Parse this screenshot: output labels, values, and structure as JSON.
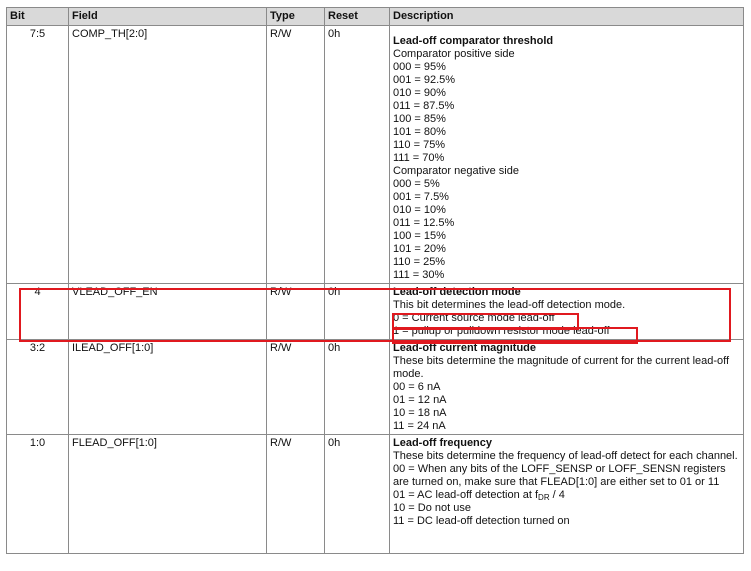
{
  "table": {
    "headers": {
      "bit": "Bit",
      "field": "Field",
      "type": "Type",
      "reset": "Reset",
      "description": "Description"
    },
    "rows": [
      {
        "bit": "7:5",
        "field": "COMP_TH[2:0]",
        "type": "R/W",
        "reset": "0h",
        "title": "Lead-off comparator threshold",
        "lines": [
          "Comparator positive side",
          "000 = 95%",
          "001 = 92.5%",
          "010 = 90%",
          "011 = 87.5%",
          "100 = 85%",
          "101 = 80%",
          "110 = 75%",
          "111 = 70%",
          "Comparator negative side",
          "000 = 5%",
          "001 = 7.5%",
          "010 = 10%",
          "011 = 12.5%",
          "100 = 15%",
          "101 = 20%",
          "110 = 25%",
          "111 = 30%"
        ]
      },
      {
        "bit": "4",
        "field": "VLEAD_OFF_EN",
        "type": "R/W",
        "reset": "0h",
        "title": "Lead-off detection mode",
        "lines": [
          "This bit determines the lead-off detection mode.",
          "0 = Current source mode lead-off",
          "1 = pullup or pulldown resistor mode lead-off"
        ]
      },
      {
        "bit": "3:2",
        "field": "ILEAD_OFF[1:0]",
        "type": "R/W",
        "reset": "0h",
        "title": "Lead-off current magnitude",
        "intro": "These bits determine the magnitude of current for the current lead-off mode.",
        "lines": [
          "00 = 6 nA",
          "01 = 12 nA",
          "10 = 18 nA",
          "11 = 24 nA"
        ]
      },
      {
        "bit": "1:0",
        "field": "FLEAD_OFF[1:0]",
        "type": "R/W",
        "reset": "0h",
        "title": "Lead-off frequency",
        "intro": "These bits determine the frequency of lead-off detect for each channel.",
        "option0": "00 = When any bits of the LOFF_SENSP or LOFF_SENSN registers are turned on, make sure that FLEAD[1:0] are either set to 01 or 11",
        "option1_pre": "01 = AC lead-off detection at f",
        "option1_sub": "DR",
        "option1_post": " / 4",
        "lines": [
          "10 = Do not use",
          "11 = DC lead-off detection turned on"
        ]
      }
    ]
  },
  "colors": {
    "header_bg": "#d9d9d9",
    "grid_line": "#8a8a8a",
    "highlight": "#e0191f"
  }
}
